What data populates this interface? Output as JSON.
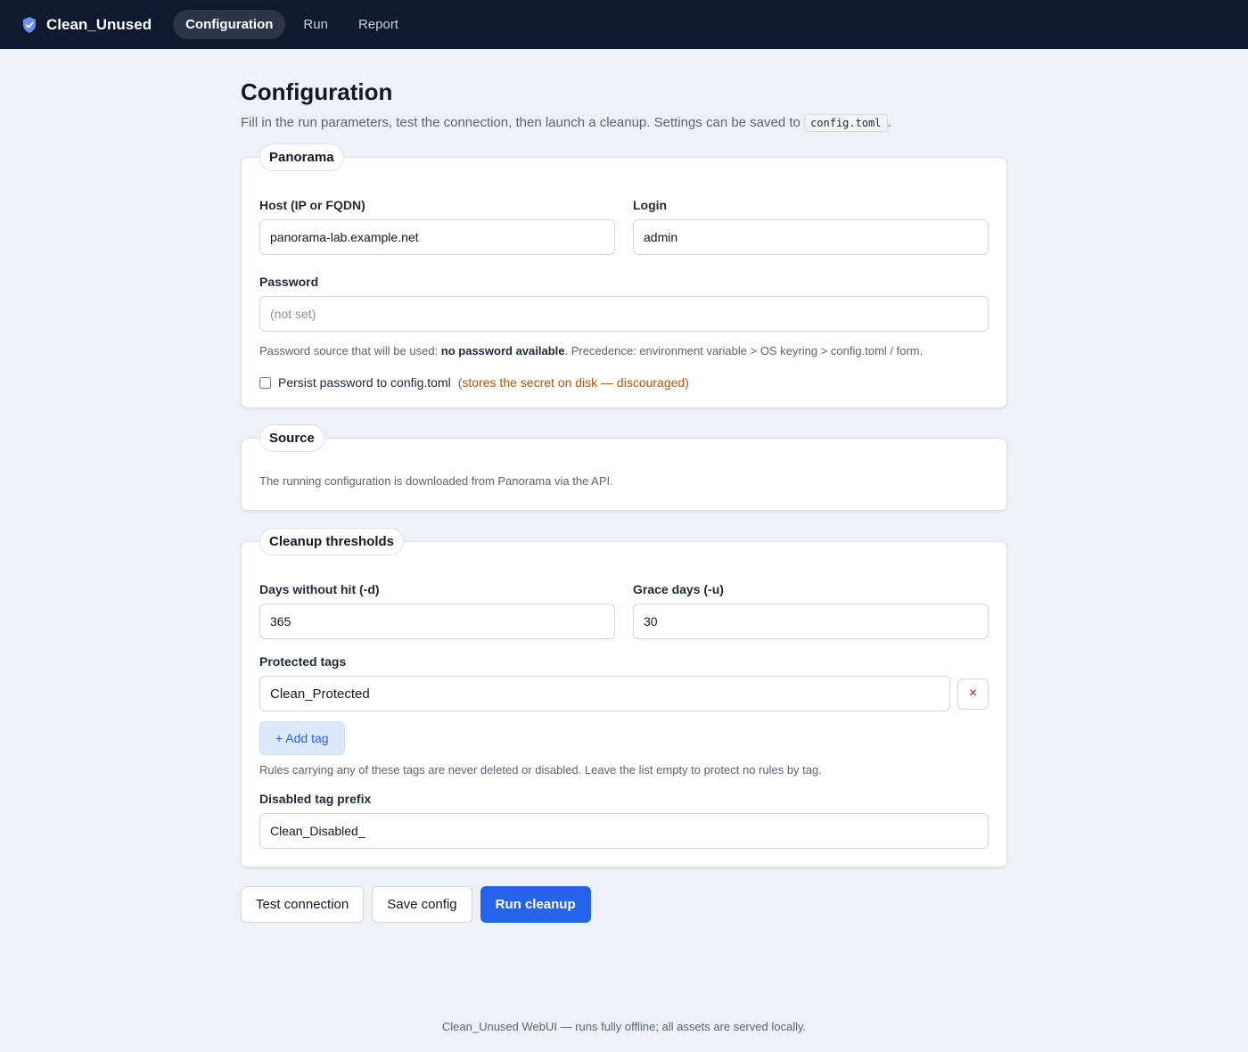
{
  "app": {
    "name": "Clean_Unused",
    "icon": "shield-check-icon"
  },
  "nav": {
    "tabs": [
      {
        "label": "Configuration",
        "active": true
      },
      {
        "label": "Run",
        "active": false
      },
      {
        "label": "Report",
        "active": false
      }
    ]
  },
  "page": {
    "title": "Configuration",
    "intro_before": "Fill in the run parameters, test the connection, then launch a cleanup. Settings can be saved to ",
    "intro_code": "config.toml",
    "intro_after": "."
  },
  "panorama": {
    "legend": "Panorama",
    "host_label": "Host (IP or FQDN)",
    "host_value": "panorama-lab.example.net",
    "login_label": "Login",
    "login_value": "admin",
    "password_label": "Password",
    "password_placeholder": "(not set)",
    "password_help_before": "Password source that will be used: ",
    "password_help_bold": "no password available",
    "password_help_after": ". Precedence: environment variable > OS keyring > config.toml / form.",
    "persist_label": "Persist password to config.toml",
    "persist_warning": "(stores the secret on disk — discouraged)",
    "persist_checked": false
  },
  "source": {
    "legend": "Source",
    "text": "The running configuration is downloaded from Panorama via the API."
  },
  "thresholds": {
    "legend": "Cleanup thresholds",
    "days_label": "Days without hit (-d)",
    "days_value": "365",
    "grace_label": "Grace days (-u)",
    "grace_value": "30",
    "protected_label": "Protected tags",
    "protected_tags": [
      "Clean_Protected"
    ],
    "remove_tag_symbol": "×",
    "add_tag_label": "+ Add tag",
    "protected_help": "Rules carrying any of these tags are never deleted or disabled. Leave the list empty to protect no rules by tag.",
    "prefix_label": "Disabled tag prefix",
    "prefix_value": "Clean_Disabled_"
  },
  "actions": {
    "test_label": "Test connection",
    "save_label": "Save config",
    "run_label": "Run cleanup"
  },
  "footer": {
    "text": "Clean_Unused WebUI — runs fully offline; all assets are served locally."
  },
  "colors": {
    "navbar": "#0f1a2e",
    "primary": "#2563eb",
    "warning": "#b45309",
    "danger": "#b91c1c"
  }
}
